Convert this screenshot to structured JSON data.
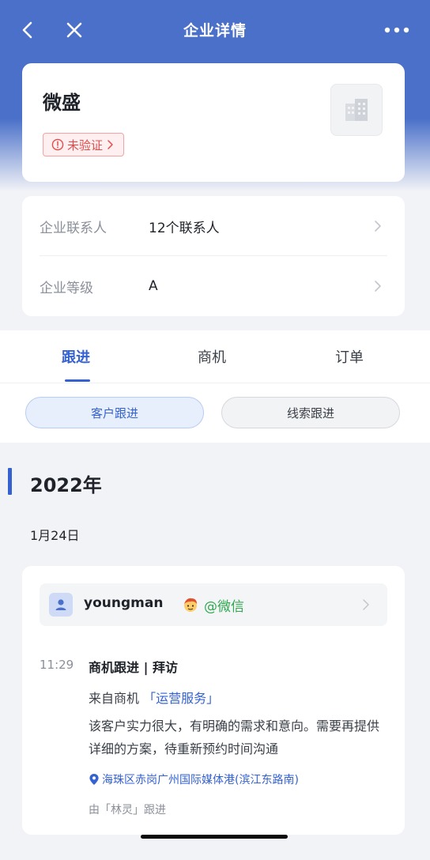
{
  "navbar": {
    "title": "企业详情",
    "back_icon": "chevron-left-icon",
    "close_icon": "close-icon",
    "more_icon": "more-horizontal-icon"
  },
  "company": {
    "name": "微盛",
    "verify_label": "未验证",
    "verify_color": "#e24c4c",
    "logo_icon": "building-icon"
  },
  "info": {
    "rows": [
      {
        "label": "企业联系人",
        "value": "12个联系人"
      },
      {
        "label": "企业等级",
        "value": "A"
      }
    ]
  },
  "tabs": {
    "items": [
      {
        "label": "跟进",
        "active": true
      },
      {
        "label": "商机",
        "active": false
      },
      {
        "label": "订单",
        "active": false
      }
    ],
    "accent": "#3562d0"
  },
  "segments": {
    "items": [
      {
        "label": "客户跟进",
        "active": true
      },
      {
        "label": "线索跟进",
        "active": false
      }
    ]
  },
  "timeline": {
    "year": "2022年",
    "date": "1月24日",
    "entry": {
      "user_name": "youngman",
      "user_source": "@微信",
      "time": "11:29",
      "title": "商机跟进 | 拜访",
      "from_label": "来自商机",
      "from_link": "「运营服务」",
      "description": "该客户实力很大，有明确的需求和意向。需要再提供详细的方案，待重新预约时间沟通",
      "location": "海珠区赤岗广州国际媒体港(滨江东路南)",
      "followed_by": "由「林灵」跟进"
    }
  }
}
